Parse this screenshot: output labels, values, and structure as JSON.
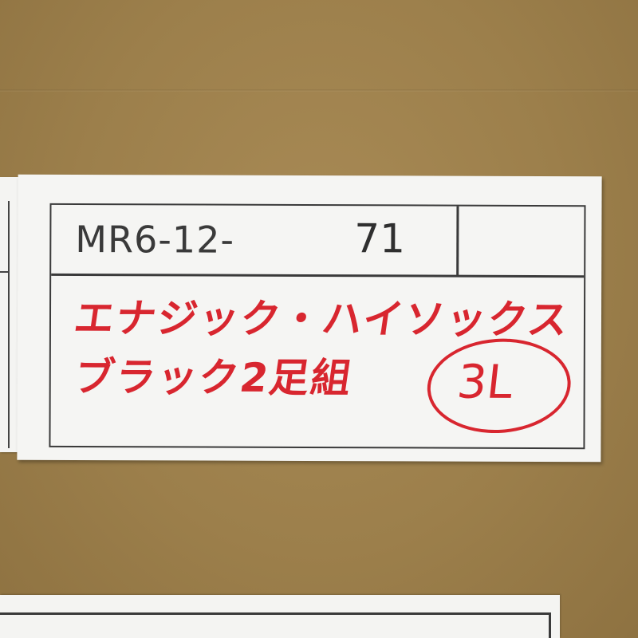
{
  "label": {
    "code_prefix": "MR6-12-",
    "code_number": "71",
    "handwritten_line_1": "エナジック・ハイソックス",
    "handwritten_line_2": "ブラック2足組",
    "size": "3L"
  },
  "colors": {
    "cardboard": "#9c7f4b",
    "label_paper": "#f5f5f3",
    "print_ink": "#3a3a3a",
    "marker_red": "#d8262f"
  }
}
